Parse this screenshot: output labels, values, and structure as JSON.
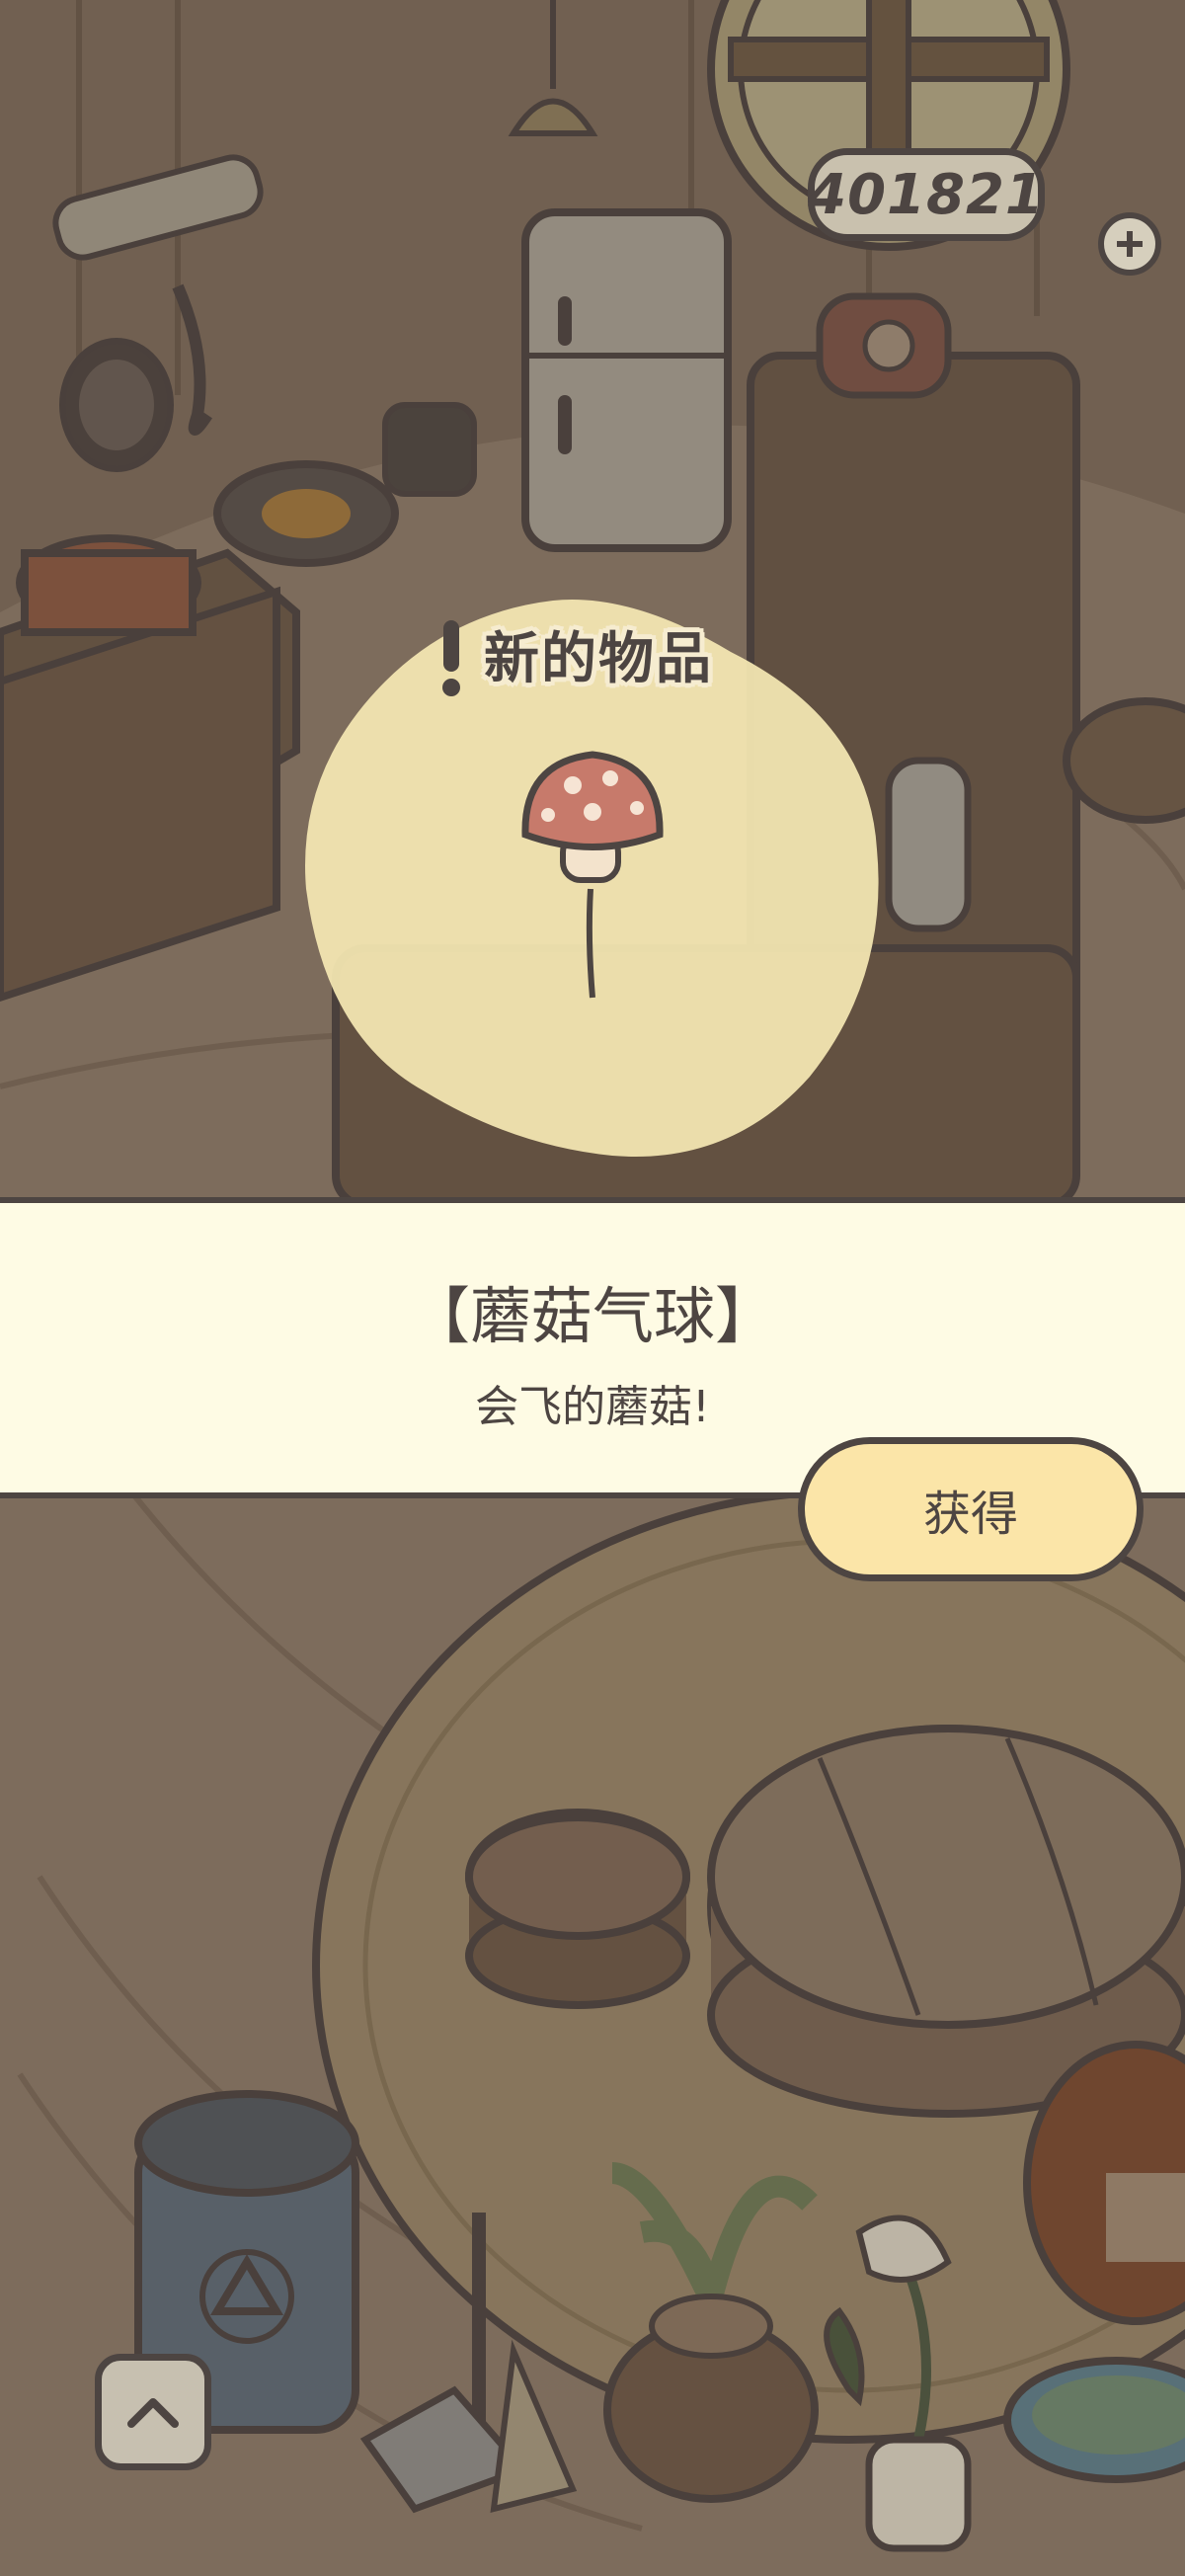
{
  "hud": {
    "counter_value": "401821"
  },
  "popup": {
    "new_item_label": "新的物品",
    "item_name": "【蘑菇气球】",
    "item_description": "会飞的蘑菇!",
    "obtain_label": "获得"
  },
  "icons": [
    "exclamation-icon",
    "mushroom-balloon-icon",
    "chevron-up-icon",
    "plus-icon",
    "recycle-icon"
  ],
  "colors": {
    "outline": "#4d4542",
    "banner": "#fefbe4",
    "button": "#fbe5a8",
    "highlight": "#f6e9b4",
    "dim_scene": "#8a7a68"
  }
}
